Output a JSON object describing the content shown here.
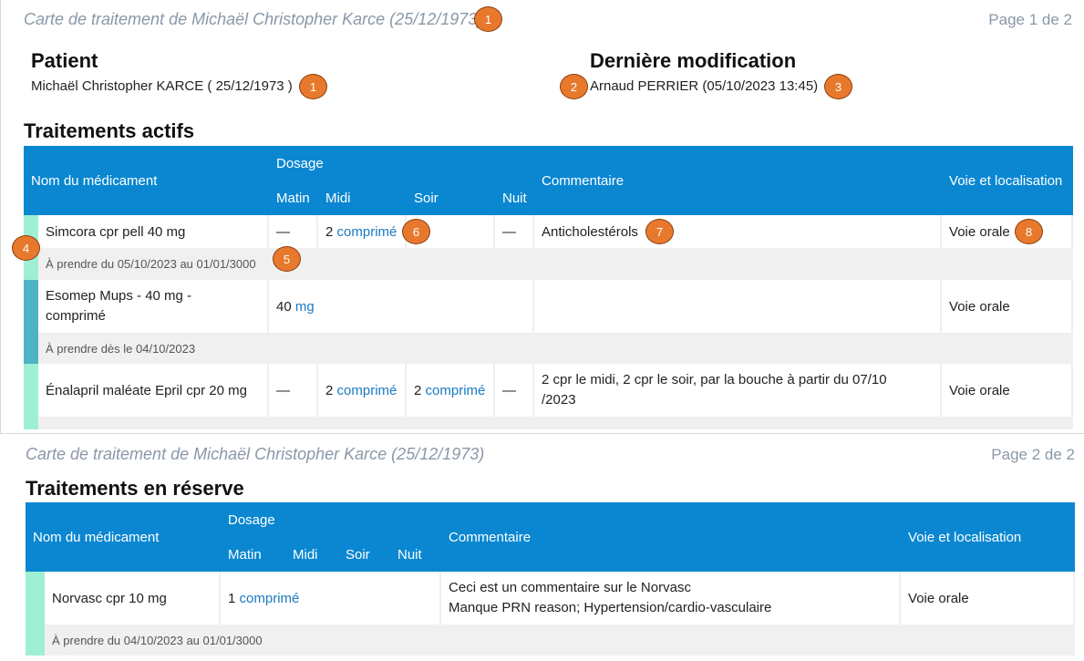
{
  "page1": {
    "header_title": "Carte de traitement de Michaël Christopher Karce (25/12/1973)",
    "page_label": "Page 1 de 2",
    "patient_heading": "Patient",
    "patient_value": "Michaël Christopher KARCE ( 25/12/1973 )",
    "lastmod_heading": "Dernière modification",
    "lastmod_value": "Arnaud PERRIER (05/10/2023 13:45)",
    "section_title": "Traitements actifs",
    "columns": {
      "name": "Nom du médicament",
      "dosage": "Dosage",
      "matin": "Matin",
      "midi": "Midi",
      "soir": "Soir",
      "nuit": "Nuit",
      "comment": "Commentaire",
      "route": "Voie et localisation"
    },
    "rows": [
      {
        "name": "Simcora cpr pell 40 mg",
        "matin": "—",
        "midi_qty": "2",
        "midi_unit": "comprimé",
        "soir": "",
        "nuit": "—",
        "comment": "Anticholestérols",
        "route": "Voie orale",
        "period": "À prendre du 05/10/2023 au 01/01/3000",
        "bar_color": "#9ff0d2"
      },
      {
        "name_line1": "Esomep Mups - 40 mg -",
        "name_line2": "comprimé",
        "dose_qty": "40",
        "dose_unit": "mg",
        "comment": "",
        "route": "Voie orale",
        "period": "À prendre dès le 04/10/2023",
        "bar_color": "#4fb3c7"
      },
      {
        "name": "Énalapril maléate Epril cpr 20 mg",
        "matin": "—",
        "midi_qty": "2",
        "midi_unit": "comprimé",
        "soir_qty": "2",
        "soir_unit": "comprimé",
        "nuit": "—",
        "comment_line1": "2 cpr le midi, 2 cpr le soir, par la bouche à partir du 07/10",
        "comment_line2": "/2023",
        "route": "Voie orale",
        "bar_color": "#9ff0d2"
      }
    ],
    "badges": [
      "1",
      "1",
      "2",
      "3",
      "4",
      "5",
      "6",
      "7",
      "8"
    ]
  },
  "page2": {
    "header_title": "Carte de traitement de Michaël Christopher Karce (25/12/1973)",
    "page_label": "Page 2 de 2",
    "section_title": "Traitements en réserve",
    "columns": {
      "name": "Nom du médicament",
      "dosage": "Dosage",
      "matin": "Matin",
      "midi": "Midi",
      "soir": "Soir",
      "nuit": "Nuit",
      "comment": "Commentaire",
      "route": "Voie et localisation"
    },
    "rows": [
      {
        "name": "Norvasc cpr 10 mg",
        "dose_qty": "1",
        "dose_unit": "comprimé",
        "comment_line1": "Ceci est un commentaire sur le Norvasc",
        "comment_line2": "Manque PRN reason; Hypertension/cardio-vasculaire",
        "route": "Voie orale",
        "period": "À prendre du 04/10/2023 au 01/01/3000",
        "bar_color": "#9ff0d2"
      }
    ]
  }
}
